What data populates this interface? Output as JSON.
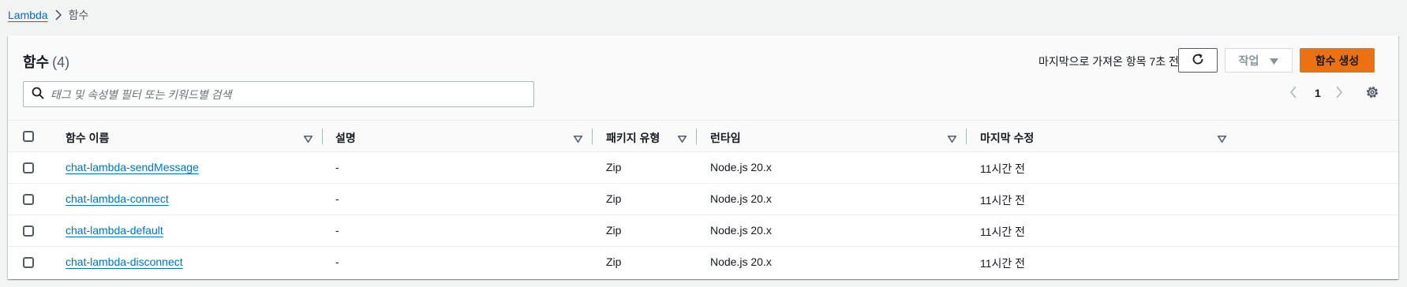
{
  "breadcrumb": {
    "root": "Lambda",
    "current": "함수"
  },
  "header": {
    "title": "함수",
    "count": "(4)",
    "refresh_text": "마지막으로 가져온 항목 7초 전",
    "actions_label": "작업",
    "create_label": "함수 생성"
  },
  "search": {
    "placeholder": "태그 및 속성별 필터 또는 키워드별 검색",
    "value": ""
  },
  "pagination": {
    "current_page": "1"
  },
  "table": {
    "columns": [
      "함수 이름",
      "설명",
      "패키지 유형",
      "런타임",
      "마지막 수정"
    ],
    "rows": [
      {
        "name": "chat-lambda-sendMessage",
        "description": "-",
        "package_type": "Zip",
        "runtime": "Node.js 20.x",
        "modified": "11시간 전"
      },
      {
        "name": "chat-lambda-connect",
        "description": "-",
        "package_type": "Zip",
        "runtime": "Node.js 20.x",
        "modified": "11시간 전"
      },
      {
        "name": "chat-lambda-default",
        "description": "-",
        "package_type": "Zip",
        "runtime": "Node.js 20.x",
        "modified": "11시간 전"
      },
      {
        "name": "chat-lambda-disconnect",
        "description": "-",
        "package_type": "Zip",
        "runtime": "Node.js 20.x",
        "modified": "11시간 전"
      }
    ]
  },
  "colors": {
    "link": "#0073bb",
    "primary_button": "#ec7211",
    "background": "#f2f3f3"
  },
  "icons": [
    "chevron-right-icon",
    "refresh-icon",
    "caret-down-icon",
    "search-icon",
    "chevron-left-icon",
    "gear-icon",
    "sort-icon"
  ]
}
